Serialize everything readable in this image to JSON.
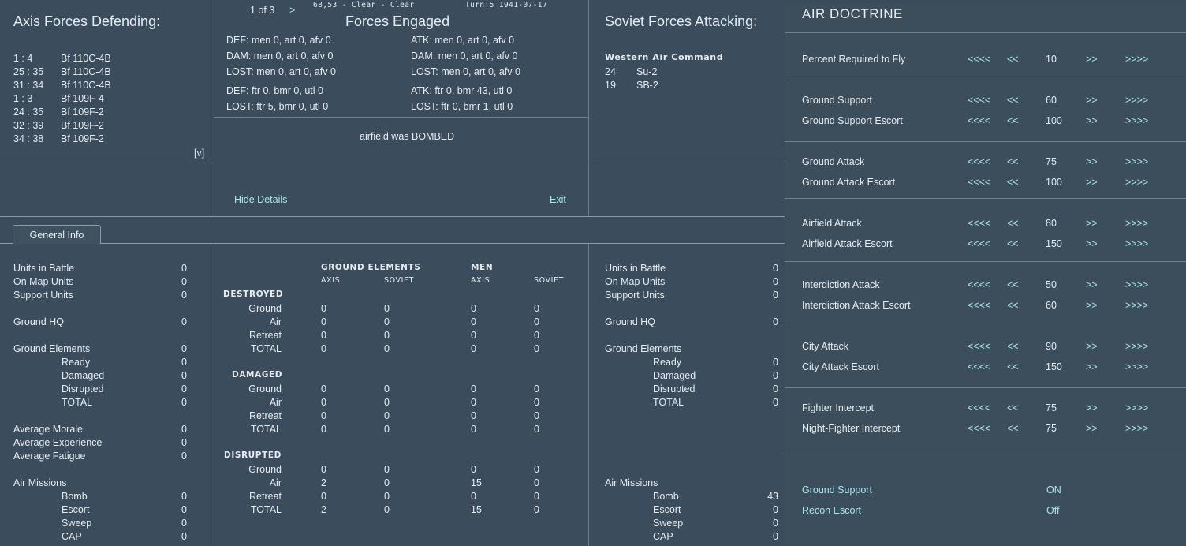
{
  "battle": {
    "axis_title": "Axis Forces Defending:",
    "soviet_title": "Soviet Forces Attacking:",
    "center_title": "Forces Engaged",
    "page_indicator": "1 of 3",
    "next_arrow": ">",
    "location_weather": "68,53 - Clear - Clear",
    "turn_date": "Turn:5  1941-07-17",
    "expand_toggle": "[v]",
    "axis_units": [
      {
        "id": "1 : 4",
        "name": "Bf 110C-4B"
      },
      {
        "id": "25 : 35",
        "name": "Bf 110C-4B"
      },
      {
        "id": "31 : 34",
        "name": "Bf 110C-4B"
      },
      {
        "id": "1 : 3",
        "name": "Bf 109F-4"
      },
      {
        "id": "24 : 35",
        "name": "Bf 109F-2"
      },
      {
        "id": "32 : 39",
        "name": "Bf 109F-2"
      },
      {
        "id": "34 : 38",
        "name": "Bf 109F-2"
      }
    ],
    "soviet_command": "Western Air Command",
    "soviet_units": [
      {
        "id": "24",
        "name": "Su-2"
      },
      {
        "id": "19",
        "name": "SB-2"
      }
    ],
    "def_lines": [
      "DEF: men 0, art 0, afv 0",
      "DAM: men 0, art 0, afv 0",
      "LOST: men 0, art 0, afv 0",
      "DEF: ftr 0, bmr 0, utl 0",
      "LOST: ftr 5, bmr 0, utl 0"
    ],
    "atk_lines": [
      "ATK: men 0, art 0, afv 0",
      "DAM: men 0, art 0, afv 0",
      "LOST: men 0, art 0, afv 0",
      "ATK: ftr 0, bmr 43, utl 0",
      "LOST: ftr 0, bmr 1, utl 0"
    ],
    "message": "airfield was BOMBED",
    "hide_details": "Hide Details",
    "exit": "Exit",
    "tab_label": "General Info"
  },
  "axis_info": [
    {
      "label": "Units in Battle",
      "value": "0"
    },
    {
      "label": "On Map Units",
      "value": "0"
    },
    {
      "label": "Support Units",
      "value": "0"
    },
    {
      "label": "Ground HQ",
      "value": "0"
    },
    {
      "label": "Ground Elements",
      "value": "0"
    },
    {
      "label": "Ready",
      "value": "0"
    },
    {
      "label": "Damaged",
      "value": "0"
    },
    {
      "label": "Disrupted",
      "value": "0"
    },
    {
      "label": "TOTAL",
      "value": "0"
    },
    {
      "label": "Average Morale",
      "value": "0"
    },
    {
      "label": "Average Experience",
      "value": "0"
    },
    {
      "label": "Average Fatigue",
      "value": "0"
    },
    {
      "label": "Air Missions",
      "value": ""
    },
    {
      "label": "Bomb",
      "value": "0"
    },
    {
      "label": "Escort",
      "value": "0"
    },
    {
      "label": "Sweep",
      "value": "0"
    },
    {
      "label": "CAP",
      "value": "0"
    }
  ],
  "soviet_info": [
    {
      "label": "Units in Battle",
      "value": "0"
    },
    {
      "label": "On Map Units",
      "value": "0"
    },
    {
      "label": "Support Units",
      "value": "0"
    },
    {
      "label": "Ground HQ",
      "value": "0"
    },
    {
      "label": "Ground Elements",
      "value": ""
    },
    {
      "label": "Ready",
      "value": "0"
    },
    {
      "label": "Damaged",
      "value": "0"
    },
    {
      "label": "Disrupted",
      "value": "0"
    },
    {
      "label": "TOTAL",
      "value": "0"
    },
    {
      "label": "Air Missions",
      "value": ""
    },
    {
      "label": "Bomb",
      "value": "43"
    },
    {
      "label": "Escort",
      "value": "0"
    },
    {
      "label": "Sweep",
      "value": "0"
    },
    {
      "label": "CAP",
      "value": "0"
    }
  ],
  "losses": {
    "header_ground": "GROUND ELEMENTS",
    "header_men": "MEN",
    "axis": "AXIS",
    "soviet": "SOVIET",
    "sections": [
      {
        "title": "DESTROYED",
        "rows": [
          {
            "label": "Ground",
            "v": [
              "0",
              "0",
              "0",
              "0"
            ]
          },
          {
            "label": "Air",
            "v": [
              "0",
              "0",
              "0",
              "0"
            ]
          },
          {
            "label": "Retreat",
            "v": [
              "0",
              "0",
              "0",
              "0"
            ]
          },
          {
            "label": "TOTAL",
            "v": [
              "0",
              "0",
              "0",
              "0"
            ]
          }
        ]
      },
      {
        "title": "DAMAGED",
        "rows": [
          {
            "label": "Ground",
            "v": [
              "0",
              "0",
              "0",
              "0"
            ]
          },
          {
            "label": "Air",
            "v": [
              "0",
              "0",
              "0",
              "0"
            ]
          },
          {
            "label": "Retreat",
            "v": [
              "0",
              "0",
              "0",
              "0"
            ]
          },
          {
            "label": "TOTAL",
            "v": [
              "0",
              "0",
              "0",
              "0"
            ]
          }
        ]
      },
      {
        "title": "DISRUPTED",
        "rows": [
          {
            "label": "Ground",
            "v": [
              "0",
              "0",
              "0",
              "0"
            ]
          },
          {
            "label": "Air",
            "v": [
              "2",
              "0",
              "15",
              "0"
            ]
          },
          {
            "label": "Retreat",
            "v": [
              "0",
              "0",
              "0",
              "0"
            ]
          },
          {
            "label": "TOTAL",
            "v": [
              "2",
              "0",
              "15",
              "0"
            ]
          }
        ]
      }
    ]
  },
  "doctrine": {
    "title": "AIR DOCTRINE",
    "btn_big_down": "<<<<",
    "btn_down": "<<",
    "btn_up": ">>",
    "btn_big_up": ">>>>",
    "rows": [
      {
        "label": "Percent Required to Fly",
        "value": "10"
      },
      {
        "label": "Ground Support",
        "value": "60"
      },
      {
        "label": "Ground Support Escort",
        "value": "100"
      },
      {
        "label": "Ground Attack",
        "value": "75"
      },
      {
        "label": "Ground Attack Escort",
        "value": "100"
      },
      {
        "label": "Airfield Attack",
        "value": "80"
      },
      {
        "label": "Airfield Attack Escort",
        "value": "150"
      },
      {
        "label": "Interdiction Attack",
        "value": "50"
      },
      {
        "label": "Interdiction Attack Escort",
        "value": "60"
      },
      {
        "label": "City Attack",
        "value": "90"
      },
      {
        "label": "City Attack Escort",
        "value": "150"
      },
      {
        "label": "Fighter Intercept",
        "value": "75"
      },
      {
        "label": "Night-Fighter Intercept",
        "value": "75"
      }
    ],
    "toggles": [
      {
        "label": "Ground Support",
        "value": "ON"
      },
      {
        "label": "Recon Escort",
        "value": "Off"
      }
    ]
  }
}
